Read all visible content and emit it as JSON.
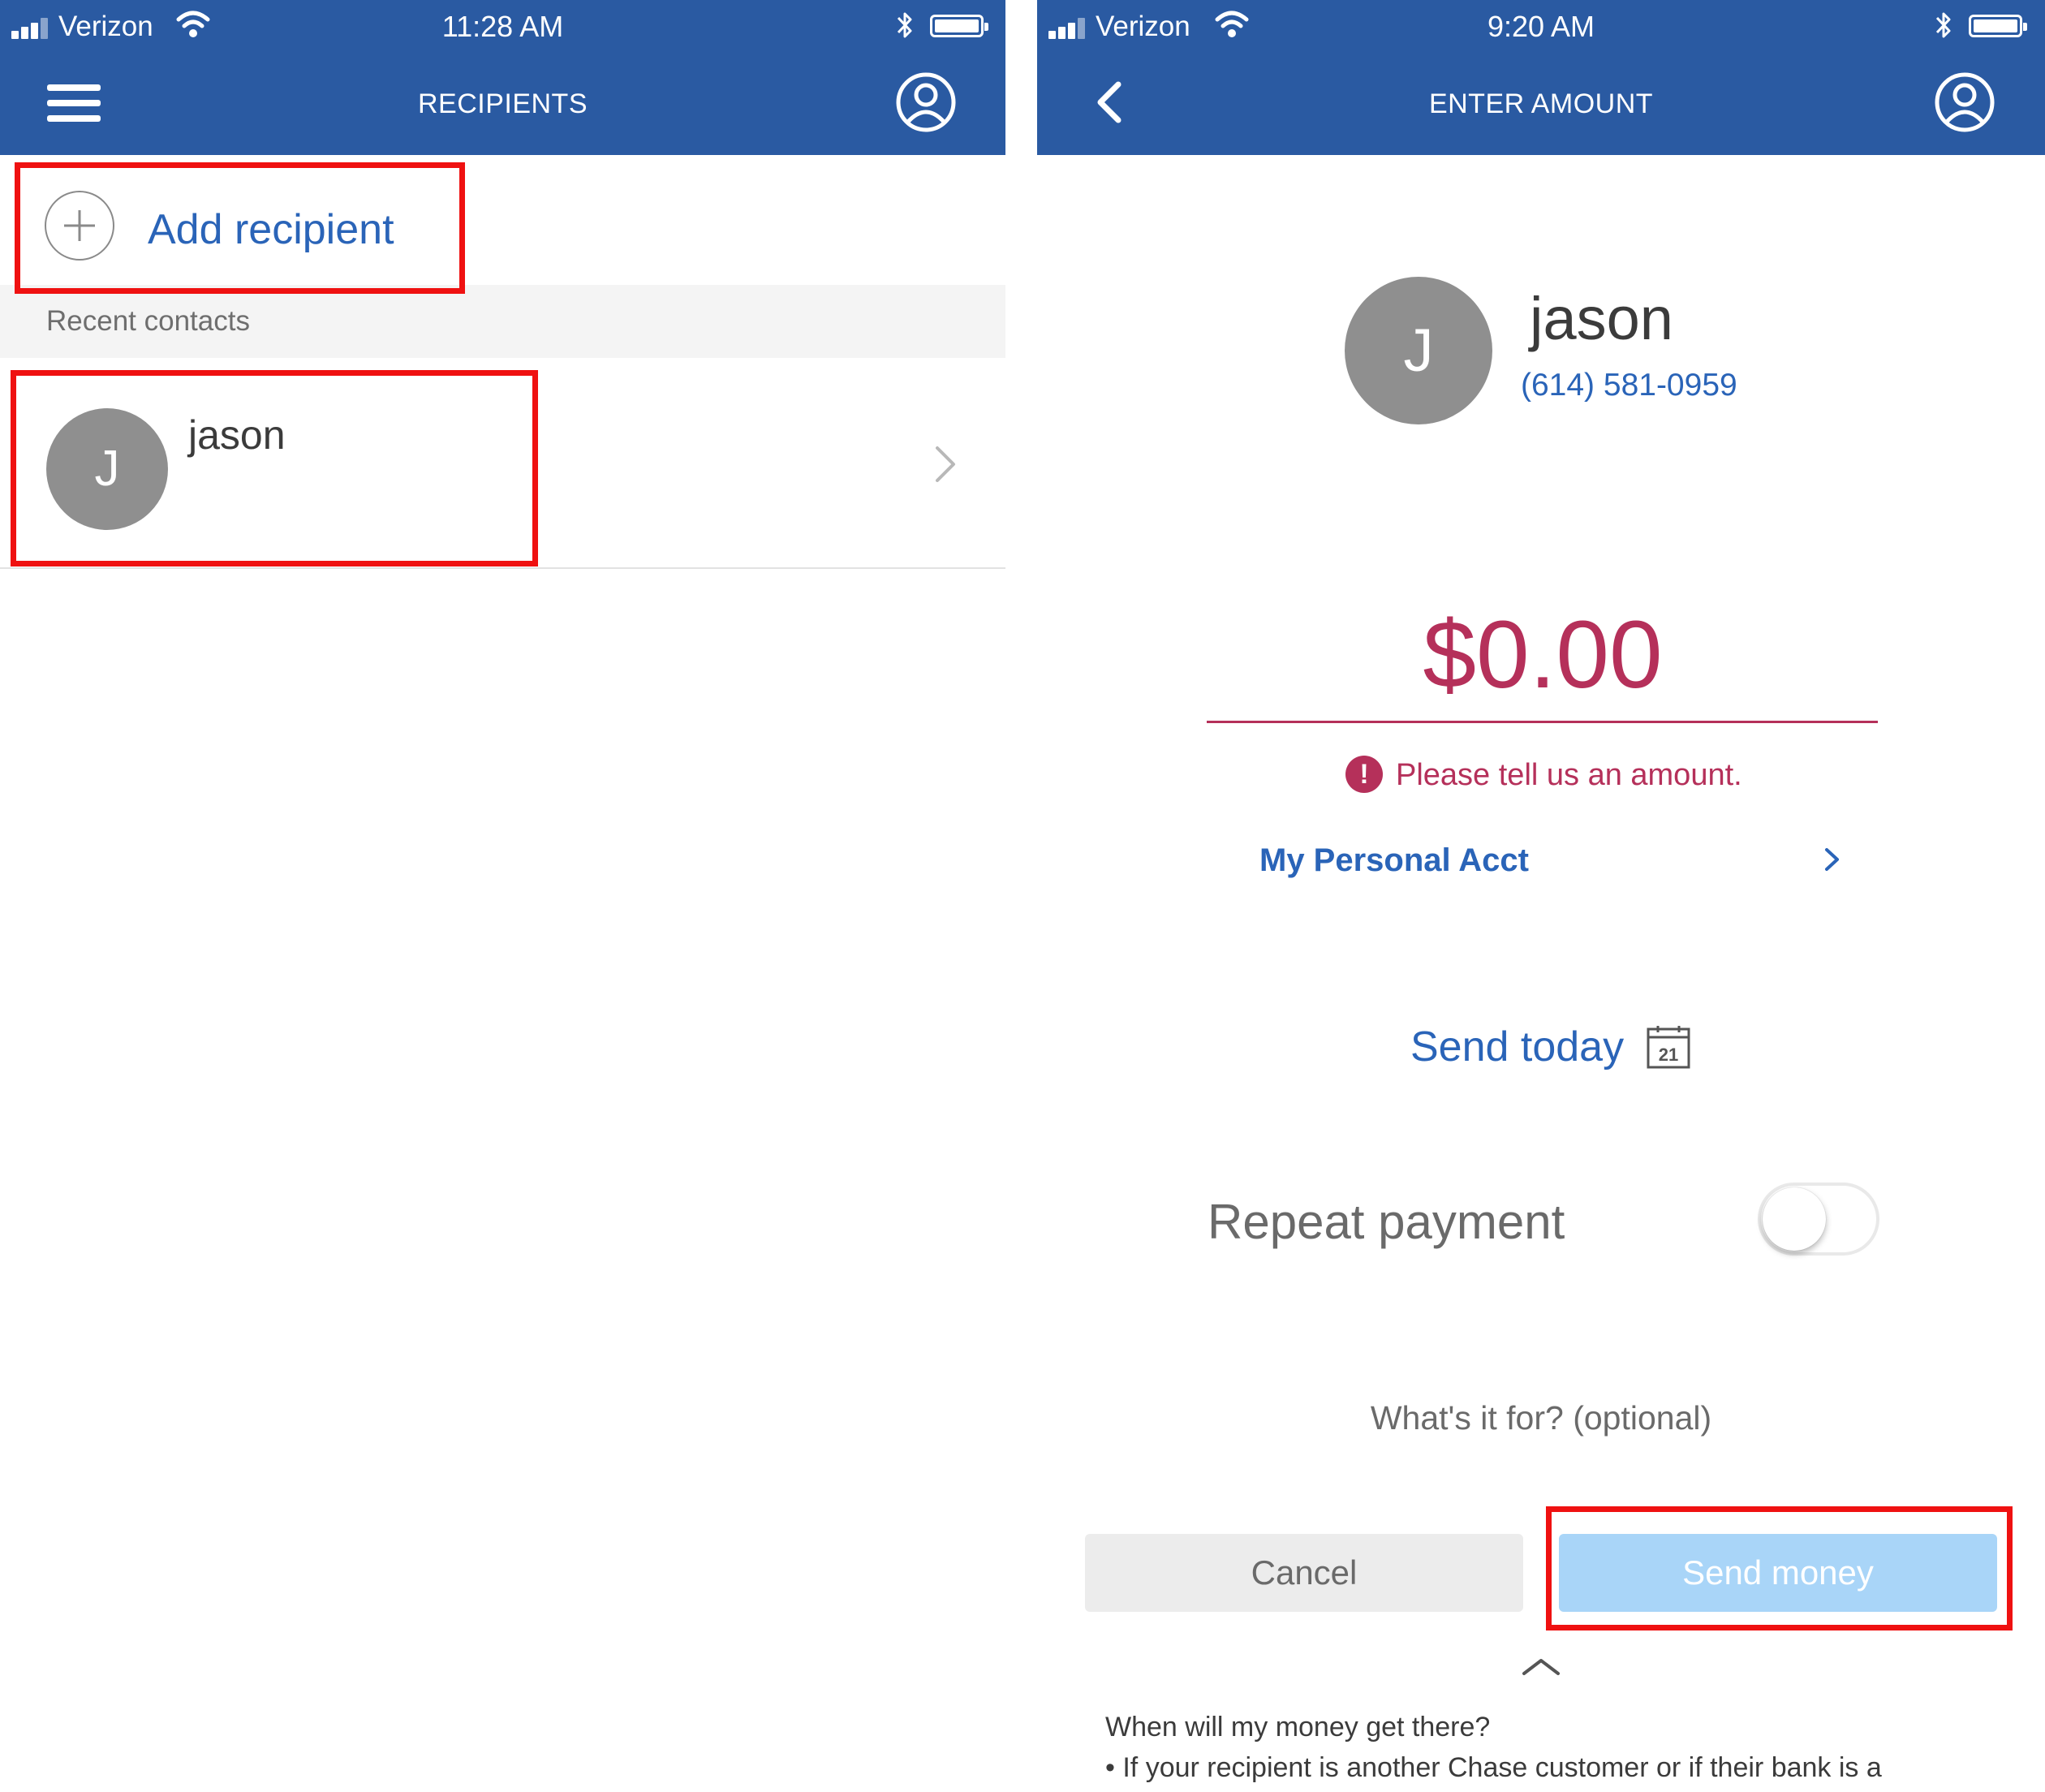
{
  "recipients_screen": {
    "status_bar": {
      "carrier": "Verizon",
      "time": "11:28 AM"
    },
    "header": {
      "title": "RECIPIENTS",
      "menu_icon": "hamburger-menu-icon",
      "profile_icon": "profile-icon"
    },
    "add_recipient": {
      "label": "Add recipient",
      "icon": "plus-circle-icon"
    },
    "recent_contacts": {
      "section_label": "Recent contacts",
      "contacts": [
        {
          "initial": "J",
          "name": "jason"
        }
      ]
    }
  },
  "enter_amount_screen": {
    "status_bar": {
      "carrier": "Verizon",
      "time": "9:20 AM"
    },
    "header": {
      "title": "ENTER AMOUNT",
      "back_icon": "back-chevron-icon",
      "profile_icon": "profile-icon"
    },
    "recipient": {
      "initial": "J",
      "name": "jason",
      "phone": "(614) 581-0959"
    },
    "amount": {
      "value": "$0.00",
      "error": "Please tell us an amount."
    },
    "account": {
      "label": "My Personal Acct"
    },
    "send_date": {
      "label": "Send today",
      "calendar_day": "21"
    },
    "repeat_payment": {
      "label": "Repeat payment",
      "enabled": false
    },
    "memo": {
      "placeholder": "What's it for? (optional)"
    },
    "buttons": {
      "cancel": "Cancel",
      "send": "Send money"
    },
    "faq": {
      "question": "When will my money get there?",
      "answer_start": "• If your recipient is another Chase customer or if their bank is a"
    }
  },
  "colors": {
    "header_blue": "#2a5aa2",
    "link_blue": "#2a64b8",
    "error_red": "#b5305a",
    "highlight_red": "#ef1111",
    "send_button_disabled": "#a9d5f8"
  }
}
